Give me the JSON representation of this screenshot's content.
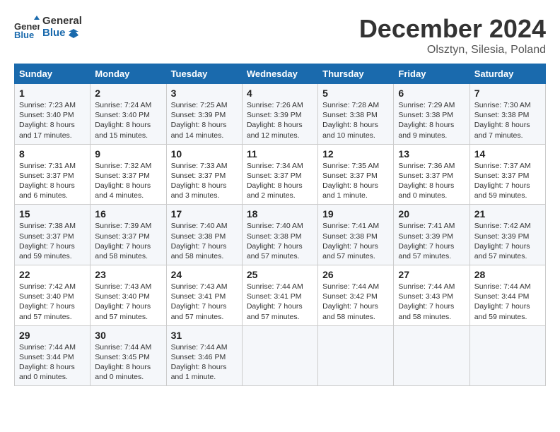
{
  "header": {
    "logo_line1": "General",
    "logo_line2": "Blue",
    "month": "December 2024",
    "location": "Olsztyn, Silesia, Poland"
  },
  "weekdays": [
    "Sunday",
    "Monday",
    "Tuesday",
    "Wednesday",
    "Thursday",
    "Friday",
    "Saturday"
  ],
  "weeks": [
    [
      {
        "day": "1",
        "sunrise": "7:23 AM",
        "sunset": "3:40 PM",
        "daylight": "8 hours and 17 minutes."
      },
      {
        "day": "2",
        "sunrise": "7:24 AM",
        "sunset": "3:40 PM",
        "daylight": "8 hours and 15 minutes."
      },
      {
        "day": "3",
        "sunrise": "7:25 AM",
        "sunset": "3:39 PM",
        "daylight": "8 hours and 14 minutes."
      },
      {
        "day": "4",
        "sunrise": "7:26 AM",
        "sunset": "3:39 PM",
        "daylight": "8 hours and 12 minutes."
      },
      {
        "day": "5",
        "sunrise": "7:28 AM",
        "sunset": "3:38 PM",
        "daylight": "8 hours and 10 minutes."
      },
      {
        "day": "6",
        "sunrise": "7:29 AM",
        "sunset": "3:38 PM",
        "daylight": "8 hours and 9 minutes."
      },
      {
        "day": "7",
        "sunrise": "7:30 AM",
        "sunset": "3:38 PM",
        "daylight": "8 hours and 7 minutes."
      }
    ],
    [
      {
        "day": "8",
        "sunrise": "7:31 AM",
        "sunset": "3:37 PM",
        "daylight": "8 hours and 6 minutes."
      },
      {
        "day": "9",
        "sunrise": "7:32 AM",
        "sunset": "3:37 PM",
        "daylight": "8 hours and 4 minutes."
      },
      {
        "day": "10",
        "sunrise": "7:33 AM",
        "sunset": "3:37 PM",
        "daylight": "8 hours and 3 minutes."
      },
      {
        "day": "11",
        "sunrise": "7:34 AM",
        "sunset": "3:37 PM",
        "daylight": "8 hours and 2 minutes."
      },
      {
        "day": "12",
        "sunrise": "7:35 AM",
        "sunset": "3:37 PM",
        "daylight": "8 hours and 1 minute."
      },
      {
        "day": "13",
        "sunrise": "7:36 AM",
        "sunset": "3:37 PM",
        "daylight": "8 hours and 0 minutes."
      },
      {
        "day": "14",
        "sunrise": "7:37 AM",
        "sunset": "3:37 PM",
        "daylight": "7 hours and 59 minutes."
      }
    ],
    [
      {
        "day": "15",
        "sunrise": "7:38 AM",
        "sunset": "3:37 PM",
        "daylight": "7 hours and 59 minutes."
      },
      {
        "day": "16",
        "sunrise": "7:39 AM",
        "sunset": "3:37 PM",
        "daylight": "7 hours and 58 minutes."
      },
      {
        "day": "17",
        "sunrise": "7:40 AM",
        "sunset": "3:38 PM",
        "daylight": "7 hours and 58 minutes."
      },
      {
        "day": "18",
        "sunrise": "7:40 AM",
        "sunset": "3:38 PM",
        "daylight": "7 hours and 57 minutes."
      },
      {
        "day": "19",
        "sunrise": "7:41 AM",
        "sunset": "3:38 PM",
        "daylight": "7 hours and 57 minutes."
      },
      {
        "day": "20",
        "sunrise": "7:41 AM",
        "sunset": "3:39 PM",
        "daylight": "7 hours and 57 minutes."
      },
      {
        "day": "21",
        "sunrise": "7:42 AM",
        "sunset": "3:39 PM",
        "daylight": "7 hours and 57 minutes."
      }
    ],
    [
      {
        "day": "22",
        "sunrise": "7:42 AM",
        "sunset": "3:40 PM",
        "daylight": "7 hours and 57 minutes."
      },
      {
        "day": "23",
        "sunrise": "7:43 AM",
        "sunset": "3:40 PM",
        "daylight": "7 hours and 57 minutes."
      },
      {
        "day": "24",
        "sunrise": "7:43 AM",
        "sunset": "3:41 PM",
        "daylight": "7 hours and 57 minutes."
      },
      {
        "day": "25",
        "sunrise": "7:44 AM",
        "sunset": "3:41 PM",
        "daylight": "7 hours and 57 minutes."
      },
      {
        "day": "26",
        "sunrise": "7:44 AM",
        "sunset": "3:42 PM",
        "daylight": "7 hours and 58 minutes."
      },
      {
        "day": "27",
        "sunrise": "7:44 AM",
        "sunset": "3:43 PM",
        "daylight": "7 hours and 58 minutes."
      },
      {
        "day": "28",
        "sunrise": "7:44 AM",
        "sunset": "3:44 PM",
        "daylight": "7 hours and 59 minutes."
      }
    ],
    [
      {
        "day": "29",
        "sunrise": "7:44 AM",
        "sunset": "3:44 PM",
        "daylight": "8 hours and 0 minutes."
      },
      {
        "day": "30",
        "sunrise": "7:44 AM",
        "sunset": "3:45 PM",
        "daylight": "8 hours and 0 minutes."
      },
      {
        "day": "31",
        "sunrise": "7:44 AM",
        "sunset": "3:46 PM",
        "daylight": "8 hours and 1 minute."
      },
      null,
      null,
      null,
      null
    ]
  ]
}
